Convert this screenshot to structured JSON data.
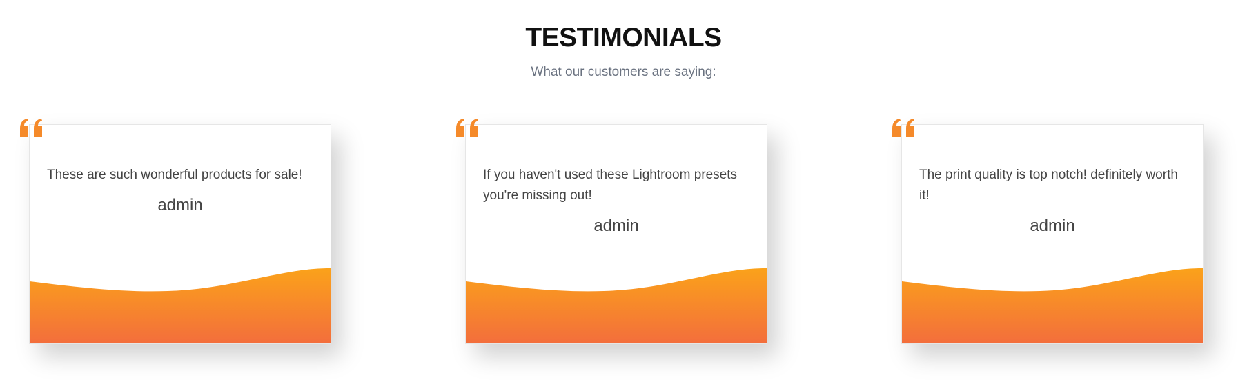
{
  "section": {
    "title": "TESTIMONIALS",
    "subtitle": "What our customers are saying:"
  },
  "testimonials": [
    {
      "text": "These are such wonderful products for sale!",
      "author": "admin"
    },
    {
      "text": "If you haven't used these Lightroom presets you're missing out!",
      "author": "admin"
    },
    {
      "text": "The print quality is top notch! definitely worth it!",
      "author": "admin"
    }
  ],
  "colors": {
    "accent_top": "#fba21a",
    "accent_bottom": "#f36e3c",
    "quote_icon": "#f58a2a",
    "title": "#111111",
    "subtitle": "#6a7280",
    "body_text": "#444444"
  },
  "icons": {
    "quote": "quote-open-icon"
  }
}
